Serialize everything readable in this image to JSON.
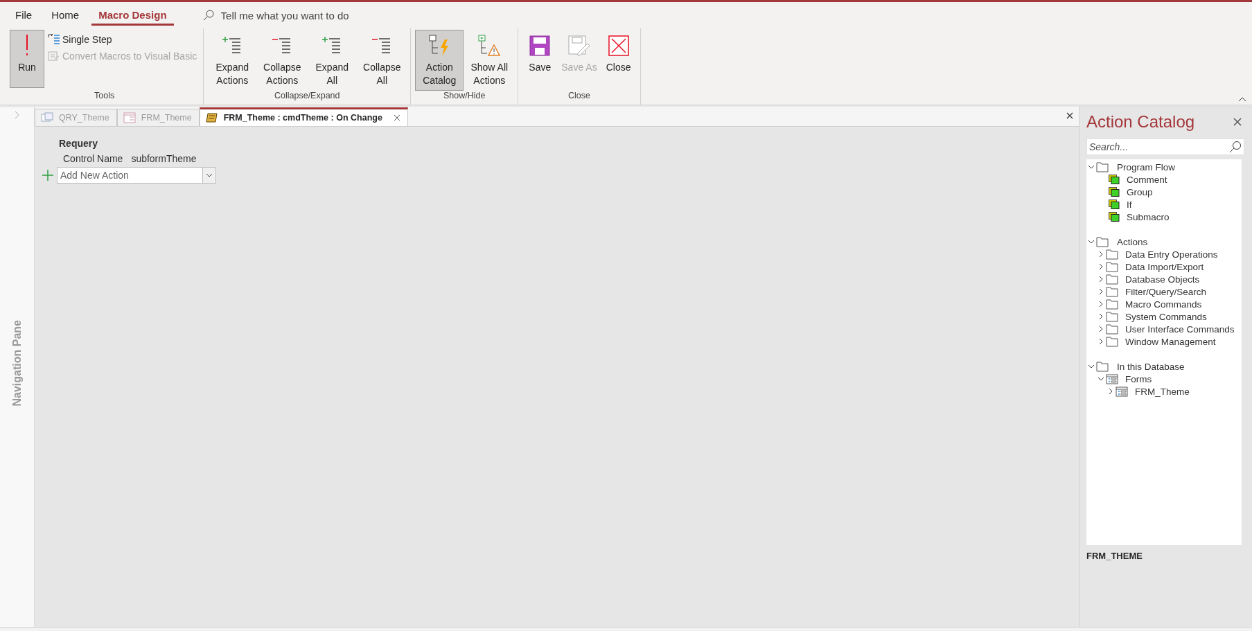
{
  "ribbon_tabs": [
    {
      "label": "File",
      "selected": false
    },
    {
      "label": "Home",
      "selected": false
    },
    {
      "label": "Macro Design",
      "selected": true
    }
  ],
  "tell_me": {
    "placeholder": "Tell me what you want to do"
  },
  "ribbon_groups": [
    {
      "label": "Tools",
      "buttons": [
        {
          "label": "Run",
          "kind": "large",
          "disabled": false,
          "pressed": true
        },
        {
          "label": "Single Step",
          "kind": "small",
          "disabled": false,
          "pressed": false
        },
        {
          "label": "Convert Macros to Visual Basic",
          "kind": "small",
          "disabled": true,
          "pressed": false
        }
      ]
    },
    {
      "label": "Collapse/Expand",
      "buttons": [
        {
          "label": "Expand Actions",
          "kind": "large",
          "disabled": false,
          "pressed": false
        },
        {
          "label": "Collapse Actions",
          "kind": "large",
          "disabled": false,
          "pressed": false
        },
        {
          "label": "Expand All",
          "kind": "large",
          "disabled": false,
          "pressed": false
        },
        {
          "label": "Collapse All",
          "kind": "large",
          "disabled": false,
          "pressed": false
        }
      ]
    },
    {
      "label": "Show/Hide",
      "buttons": [
        {
          "label": "Action Catalog",
          "kind": "large",
          "disabled": false,
          "pressed": true
        },
        {
          "label": "Show All Actions",
          "kind": "large",
          "disabled": false,
          "pressed": false
        }
      ]
    },
    {
      "label": "Close",
      "buttons": [
        {
          "label": "Save",
          "kind": "large",
          "disabled": false,
          "pressed": false
        },
        {
          "label": "Save As",
          "kind": "large",
          "disabled": true,
          "pressed": false
        },
        {
          "label": "Close",
          "kind": "large",
          "disabled": false,
          "pressed": false
        }
      ]
    }
  ],
  "navigation_pane": {
    "label": "Navigation Pane"
  },
  "document_tabs": [
    {
      "label": "QRY_Theme",
      "kind": "query",
      "selected": false
    },
    {
      "label": "FRM_Theme",
      "kind": "form",
      "selected": false
    },
    {
      "label": "FRM_Theme : cmdTheme : On Change",
      "kind": "macro",
      "selected": true
    }
  ],
  "macro": {
    "action": "Requery",
    "arguments": [
      {
        "name": "Control Name",
        "value": "subformTheme"
      }
    ],
    "add_action": {
      "placeholder": "Add New Action"
    }
  },
  "action_catalog": {
    "title": "Action Catalog",
    "search": {
      "placeholder": "Search..."
    },
    "tree": [
      {
        "label": "Program Flow",
        "kind": "folder",
        "expanded": true,
        "children": [
          {
            "label": "Comment",
            "kind": "action"
          },
          {
            "label": "Group",
            "kind": "action"
          },
          {
            "label": "If",
            "kind": "action"
          },
          {
            "label": "Submacro",
            "kind": "action"
          }
        ]
      },
      {
        "label": "Actions",
        "kind": "folder",
        "expanded": true,
        "children": [
          {
            "label": "Data Entry Operations",
            "kind": "folder",
            "expanded": false
          },
          {
            "label": "Data Import/Export",
            "kind": "folder",
            "expanded": false
          },
          {
            "label": "Database Objects",
            "kind": "folder",
            "expanded": false
          },
          {
            "label": "Filter/Query/Search",
            "kind": "folder",
            "expanded": false
          },
          {
            "label": "Macro Commands",
            "kind": "folder",
            "expanded": false
          },
          {
            "label": "System Commands",
            "kind": "folder",
            "expanded": false
          },
          {
            "label": "User Interface Commands",
            "kind": "folder",
            "expanded": false
          },
          {
            "label": "Window Management",
            "kind": "folder",
            "expanded": false
          }
        ]
      },
      {
        "label": "In this Database",
        "kind": "folder",
        "expanded": true,
        "children": [
          {
            "label": "Forms",
            "kind": "form",
            "expanded": true,
            "children": [
              {
                "label": "FRM_Theme",
                "kind": "form",
                "expanded": false
              }
            ]
          }
        ]
      }
    ],
    "footer": "FRM_THEME"
  }
}
